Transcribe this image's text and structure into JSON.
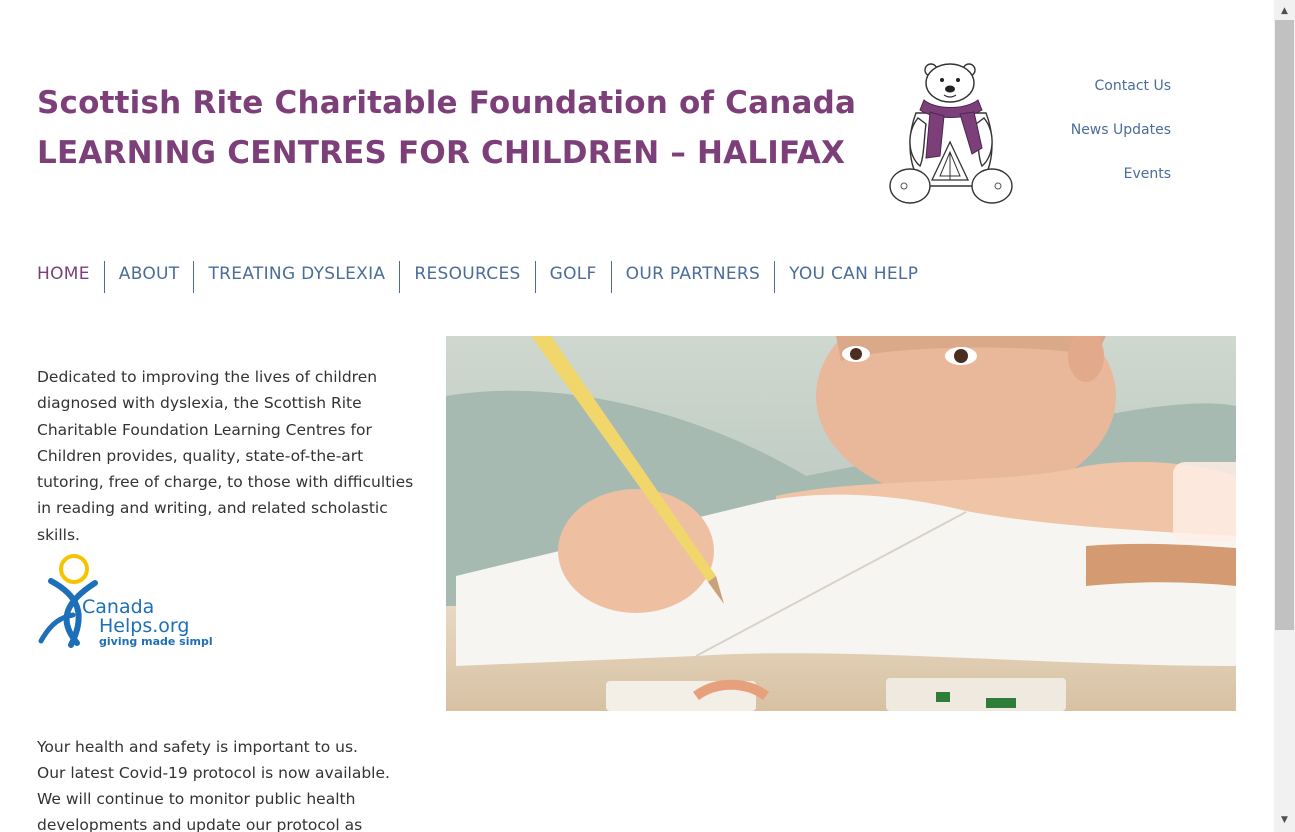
{
  "header": {
    "title_line1": "Scottish Rite Charitable Foundation of Canada",
    "title_line2": "LEARNING CENTRES FOR CHILDREN – HALIFAX",
    "title_color": "#7d3f79"
  },
  "top_links": {
    "contact": "Contact Us",
    "news": "News Updates",
    "events": "Events",
    "color": "#4a6d99"
  },
  "nav": {
    "items": [
      {
        "label": "HOME"
      },
      {
        "label": "ABOUT"
      },
      {
        "label": "TREATING DYSLEXIA"
      },
      {
        "label": "RESOURCES"
      },
      {
        "label": "GOLF"
      },
      {
        "label": "OUR PARTNERS"
      },
      {
        "label": "YOU CAN HELP"
      }
    ]
  },
  "intro": {
    "text": "Dedicated to improving the lives of children diagnosed with dyslexia, the Scottish Rite Charitable Foundation Learning Centres for Children provides, quality, state-of-the-art tutoring, free of charge, to those with difficulties in reading and writing, and related scholastic skills."
  },
  "canadahelps": {
    "line1": "Canada",
    "line2": "Helps.org",
    "tagline": "giving made simple"
  },
  "covid": {
    "line1": "Your health and safety is important to us.",
    "line2": "Our latest Covid-19 protocol is now available.",
    "line3": "We will continue to monitor public health",
    "line4": "developments and update our protocol as"
  },
  "scrollbar": {
    "up_icon": "▲",
    "down_icon": "▼"
  }
}
